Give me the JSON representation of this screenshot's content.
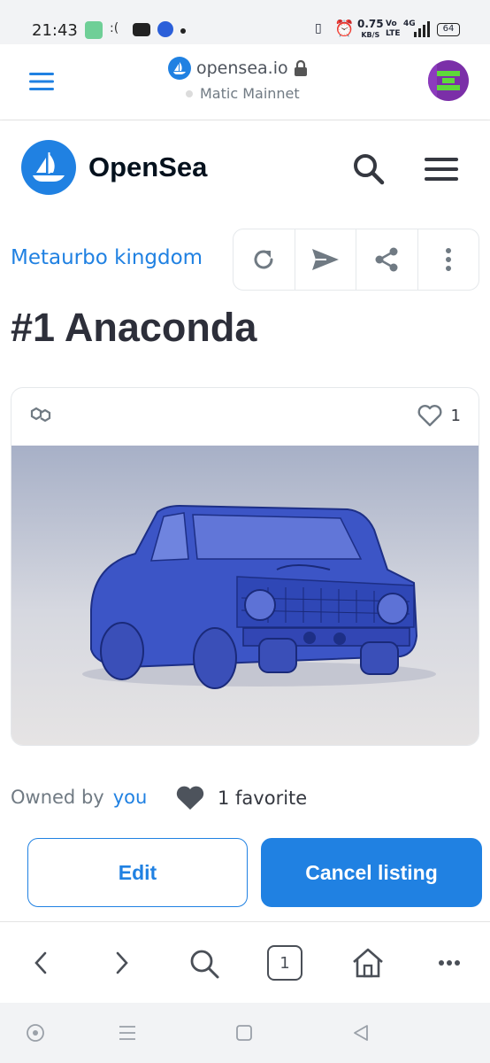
{
  "status_bar": {
    "time": "21:43",
    "net_speed": "0.75",
    "net_unit": "KB/S",
    "volte": "Vo",
    "lte": "LTE",
    "signal": "4G",
    "battery": "64"
  },
  "browser": {
    "url": "opensea.io",
    "network": "Matic Mainnet"
  },
  "header": {
    "brand": "OpenSea"
  },
  "collection": {
    "name": "Metaurbo kingdom"
  },
  "item": {
    "title": "#1 Anaconda",
    "favorites_count": "1",
    "owned_prefix": "Owned by",
    "owner": "you",
    "favorites_label": "1 favorite"
  },
  "buttons": {
    "edit": "Edit",
    "cancel": "Cancel listing"
  },
  "bottom_nav": {
    "tab_count": "1"
  },
  "colors": {
    "accent": "#2081e2",
    "text": "#1f2433",
    "muted": "#707a83"
  }
}
